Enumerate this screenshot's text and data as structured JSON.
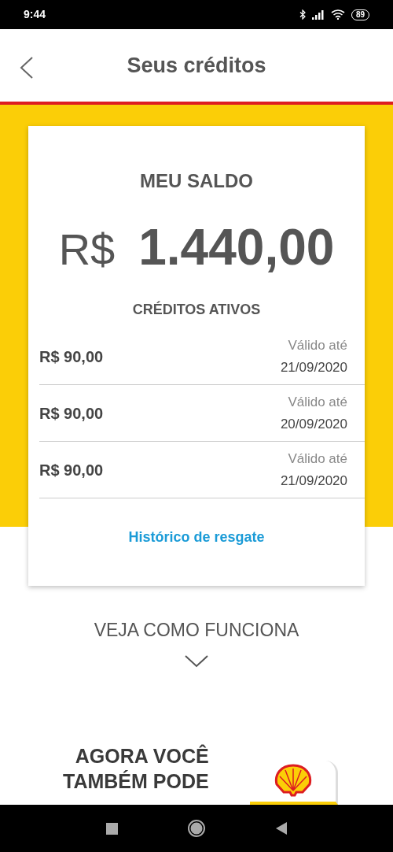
{
  "status_bar": {
    "time": "9:44",
    "battery": "89"
  },
  "header": {
    "title": "Seus créditos"
  },
  "balance": {
    "heading": "MEU SALDO",
    "currency": "R$",
    "amount": "1.440,00"
  },
  "credits": {
    "heading": "CRÉDITOS ATIVOS",
    "items": [
      {
        "amount": "R$ 90,00",
        "valid_label": "Válido até",
        "date": "21/09/2020"
      },
      {
        "amount": "R$ 90,00",
        "valid_label": "Válido até",
        "date": "20/09/2020"
      },
      {
        "amount": "R$ 90,00",
        "valid_label": "Válido até",
        "date": "21/09/2020"
      }
    ]
  },
  "history_link": "Histórico de resgate",
  "how_it_works": "VEJA COMO FUNCIONA",
  "promo": {
    "lines": [
      "AGORA VOCÊ",
      "TAMBÉM PODE"
    ]
  }
}
